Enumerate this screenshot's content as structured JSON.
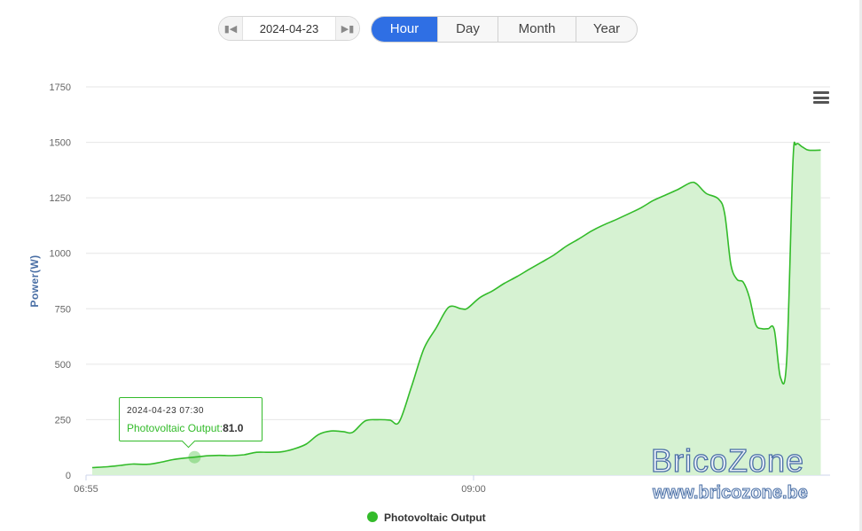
{
  "controls": {
    "date": "2024-04-23",
    "prev_icon": "skip-previous-icon",
    "next_icon": "skip-next-icon",
    "tabs": [
      {
        "label": "Hour",
        "active": true
      },
      {
        "label": "Day",
        "active": false
      },
      {
        "label": "Month",
        "active": false
      },
      {
        "label": "Year",
        "active": false
      }
    ],
    "menu_icon": "hamburger-menu-icon"
  },
  "colors": {
    "accent": "#2f6fe4",
    "series_line": "#33bb2a",
    "series_fill": "#d6f2d2",
    "axis_title": "#4a6fa5",
    "grid": "#e6e6e6"
  },
  "tooltip": {
    "timestamp": "2024-04-23 07:30",
    "series_label": "Photovoltaic Output:",
    "value": "81.0"
  },
  "watermark": {
    "line1": "BricoZone",
    "line2": "www.bricozone.be"
  },
  "chart_data": {
    "type": "area",
    "title": "",
    "xlabel": "",
    "ylabel": "Power(W)",
    "ylim": [
      0,
      1750
    ],
    "yticks": [
      0,
      250,
      500,
      750,
      1000,
      1250,
      1500,
      1750
    ],
    "xticks": [
      "06:55",
      "09:00"
    ],
    "grid": true,
    "legend_position": "bottom-center",
    "series": [
      {
        "name": "Photovoltaic Output",
        "color": "#33bb2a",
        "points": [
          [
            "06:57",
            34
          ],
          [
            "07:02",
            38
          ],
          [
            "07:06",
            44
          ],
          [
            "07:10",
            50
          ],
          [
            "07:15",
            49
          ],
          [
            "07:19",
            58
          ],
          [
            "07:23",
            70
          ],
          [
            "07:27",
            77
          ],
          [
            "07:30",
            81
          ],
          [
            "07:34",
            87
          ],
          [
            "07:38",
            89
          ],
          [
            "07:42",
            88
          ],
          [
            "07:46",
            92
          ],
          [
            "07:50",
            103
          ],
          [
            "07:54",
            103
          ],
          [
            "07:58",
            105
          ],
          [
            "08:02",
            118
          ],
          [
            "08:06",
            140
          ],
          [
            "08:10",
            183
          ],
          [
            "08:14",
            199
          ],
          [
            "08:18",
            196
          ],
          [
            "08:21",
            193
          ],
          [
            "08:25",
            244
          ],
          [
            "08:29",
            250
          ],
          [
            "08:33",
            248
          ],
          [
            "08:36",
            240
          ],
          [
            "08:40",
            400
          ],
          [
            "08:44",
            570
          ],
          [
            "08:48",
            665
          ],
          [
            "08:52",
            757
          ],
          [
            "08:56",
            750
          ],
          [
            "08:58",
            752
          ],
          [
            "09:02",
            800
          ],
          [
            "09:06",
            830
          ],
          [
            "09:10",
            865
          ],
          [
            "09:14",
            895
          ],
          [
            "09:18",
            928
          ],
          [
            "09:22",
            960
          ],
          [
            "09:26",
            993
          ],
          [
            "09:30",
            1033
          ],
          [
            "09:34",
            1065
          ],
          [
            "09:38",
            1100
          ],
          [
            "09:42",
            1128
          ],
          [
            "09:46",
            1152
          ],
          [
            "09:50",
            1178
          ],
          [
            "09:54",
            1205
          ],
          [
            "09:58",
            1238
          ],
          [
            "10:02",
            1263
          ],
          [
            "10:06",
            1288
          ],
          [
            "10:10",
            1318
          ],
          [
            "10:12",
            1312
          ],
          [
            "10:15",
            1270
          ],
          [
            "10:19",
            1245
          ],
          [
            "10:21",
            1180
          ],
          [
            "10:23",
            950
          ],
          [
            "10:25",
            882
          ],
          [
            "10:27",
            870
          ],
          [
            "10:29",
            800
          ],
          [
            "10:31",
            680
          ],
          [
            "10:33",
            660
          ],
          [
            "10:35",
            660
          ],
          [
            "10:37",
            655
          ],
          [
            "10:39",
            440
          ],
          [
            "10:41",
            520
          ],
          [
            "10:43",
            1400
          ],
          [
            "10:44",
            1490
          ],
          [
            "10:46",
            1480
          ],
          [
            "10:48",
            1465
          ],
          [
            "10:52",
            1465
          ]
        ]
      }
    ]
  }
}
